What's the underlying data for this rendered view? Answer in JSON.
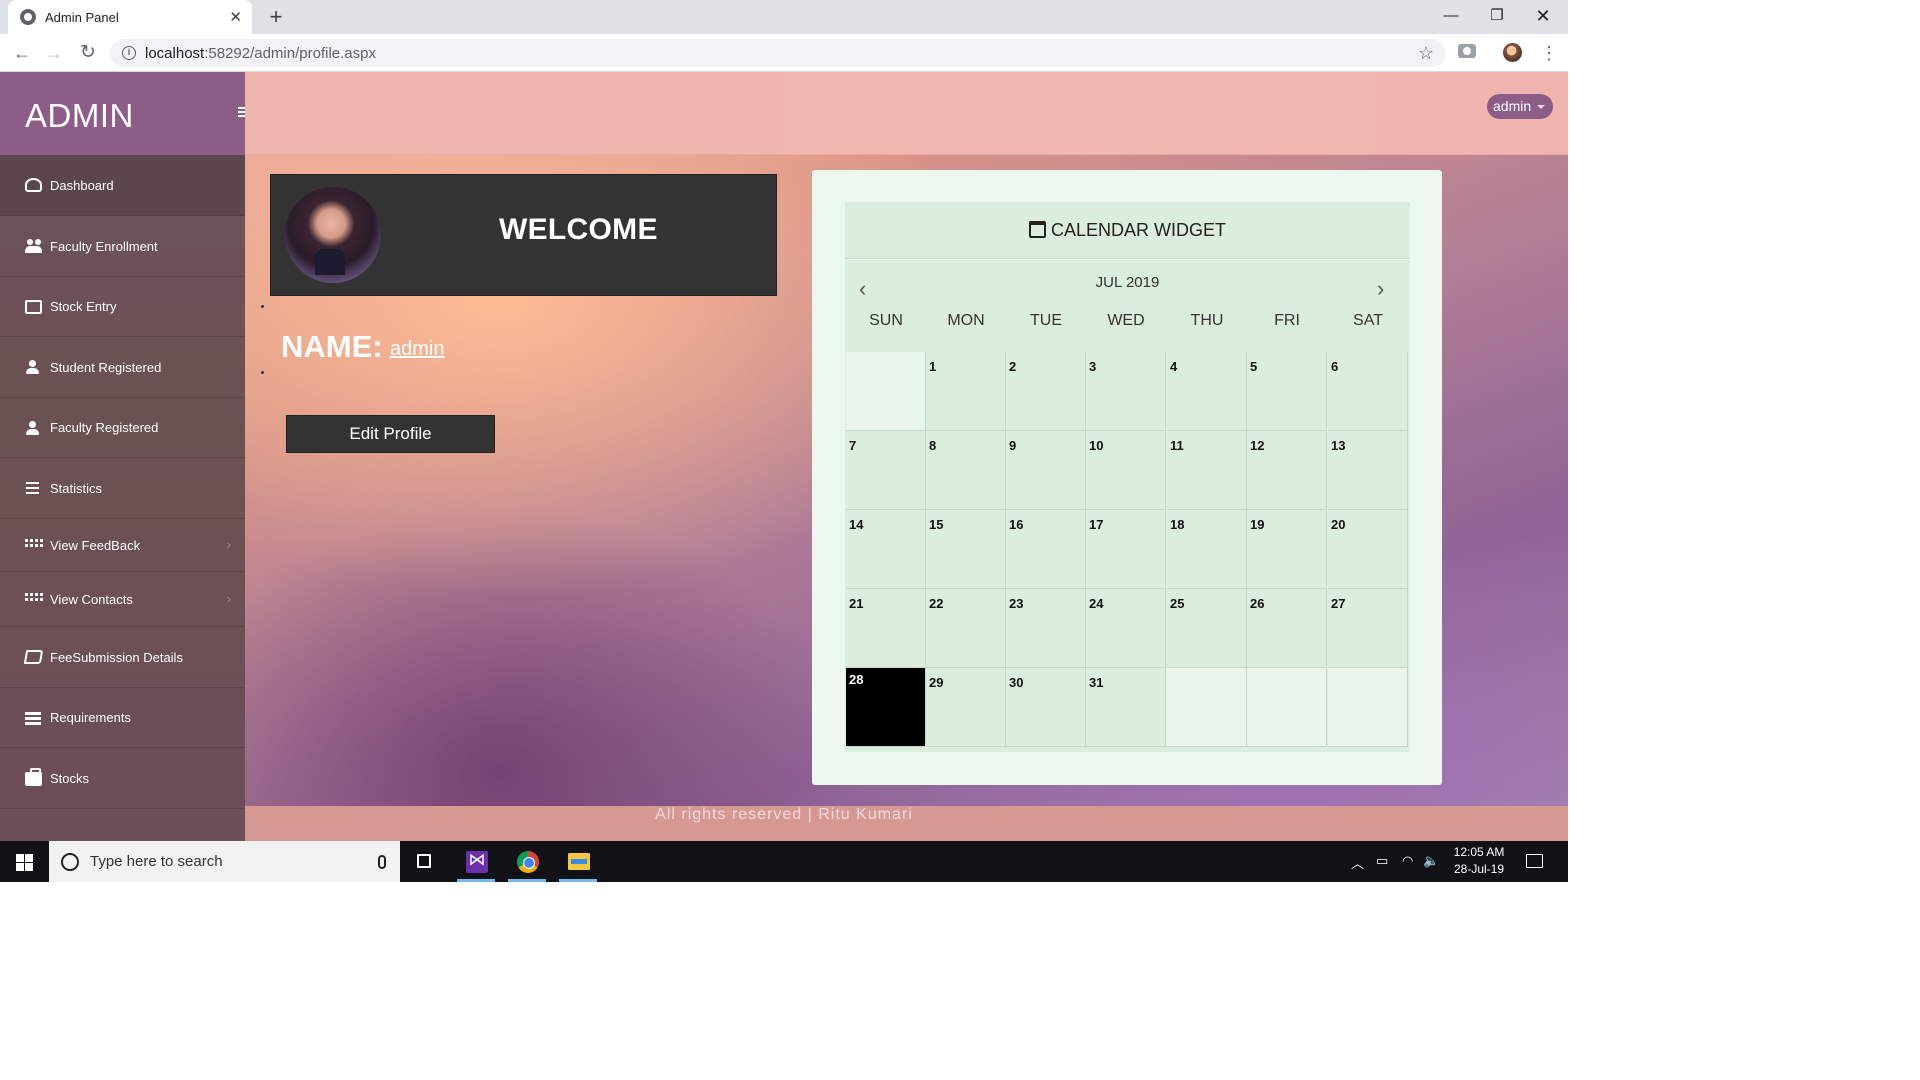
{
  "browser": {
    "tab_title": "Admin Panel",
    "tab_close": "✕",
    "new_tab": "+",
    "window_minimize": "—",
    "window_maximize": "❐",
    "window_close": "✕",
    "url_host": "localhost",
    "url_path": ":58292/admin/profile.aspx",
    "back": "←",
    "forward": "→",
    "reload": "↻",
    "info": "i",
    "star": "☆",
    "menu": "⋮"
  },
  "sidebar": {
    "brand": "ADMIN",
    "items": [
      {
        "label": "Dashboard",
        "icon": "dashboard-icon"
      },
      {
        "label": "Faculty Enrollment",
        "icon": "users-icon"
      },
      {
        "label": "Stock Entry",
        "icon": "edit-icon"
      },
      {
        "label": "Student Registered",
        "icon": "user-icon"
      },
      {
        "label": "Faculty Registered",
        "icon": "user-icon"
      },
      {
        "label": "Statistics",
        "icon": "bars-icon"
      },
      {
        "label": "View FeedBack",
        "icon": "grid-icon",
        "has_submenu": true
      },
      {
        "label": "View Contacts",
        "icon": "grid-icon",
        "has_submenu": true
      },
      {
        "label": "FeeSubmission Details",
        "icon": "book-icon"
      },
      {
        "label": "Requirements",
        "icon": "list-icon"
      },
      {
        "label": "Stocks",
        "icon": "briefcase-icon"
      }
    ],
    "chevron": "›"
  },
  "topbar": {
    "user": "admin"
  },
  "profile": {
    "welcome": "WELCOME",
    "name_label": "NAME:",
    "name_value": "admin",
    "edit_button": "Edit Profile"
  },
  "calendar": {
    "title": "CALENDAR WIDGET",
    "month": "JUL 2019",
    "prev": "‹",
    "next": "›",
    "weekdays": [
      "SUN",
      "MON",
      "TUE",
      "WED",
      "THU",
      "FRI",
      "SAT"
    ],
    "days": [
      "",
      "1",
      "2",
      "3",
      "4",
      "5",
      "6",
      "7",
      "8",
      "9",
      "10",
      "11",
      "12",
      "13",
      "14",
      "15",
      "16",
      "17",
      "18",
      "19",
      "20",
      "21",
      "22",
      "23",
      "24",
      "25",
      "26",
      "27",
      "28",
      "29",
      "30",
      "31",
      "",
      "",
      ""
    ],
    "today": "28"
  },
  "footer": {
    "text": "All rights reserved | Ritu Kumari"
  },
  "taskbar": {
    "search_placeholder": "Type here to search",
    "time": "12:05 AM",
    "date": "28-Jul-19",
    "tray_up": "︿",
    "tray_battery": "▭",
    "tray_wifi": "◠",
    "tray_volume": "🔈"
  },
  "colors": {
    "sidebar_brand": "#8b5d87",
    "card_dark": "#333333",
    "calendar_bg": "#dbeddc",
    "today_bg": "#000000",
    "footer": "#d69892"
  }
}
